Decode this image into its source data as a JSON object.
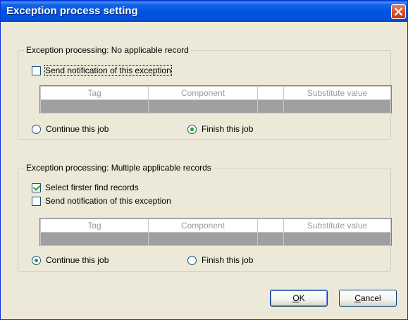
{
  "window": {
    "title": "Exception process setting",
    "close_icon": "close-icon"
  },
  "group1": {
    "legend": "Exception processing: No applicable record",
    "send_notification": {
      "label": "Send notification of this exception",
      "checked": false
    },
    "table": {
      "headers": [
        "Tag",
        "Component",
        "",
        "Substitute value"
      ]
    },
    "continue_radio": {
      "label": "Continue this job",
      "selected": false
    },
    "finish_radio": {
      "label": "Finish this job",
      "selected": true
    }
  },
  "group2": {
    "legend": "Exception processing: Multiple applicable records",
    "select_first": {
      "label": "Select firster find records",
      "checked": true
    },
    "send_notification": {
      "label": "Send notification of this exception",
      "checked": false
    },
    "table": {
      "headers": [
        "Tag",
        "Component",
        "",
        "Substitute value"
      ]
    },
    "continue_radio": {
      "label": "Continue this job",
      "selected": true
    },
    "finish_radio": {
      "label": "Finish this job",
      "selected": false
    }
  },
  "buttons": {
    "ok": {
      "mnemonic": "O",
      "rest": "K"
    },
    "cancel": {
      "mnemonic": "C",
      "rest": "ancel"
    }
  }
}
